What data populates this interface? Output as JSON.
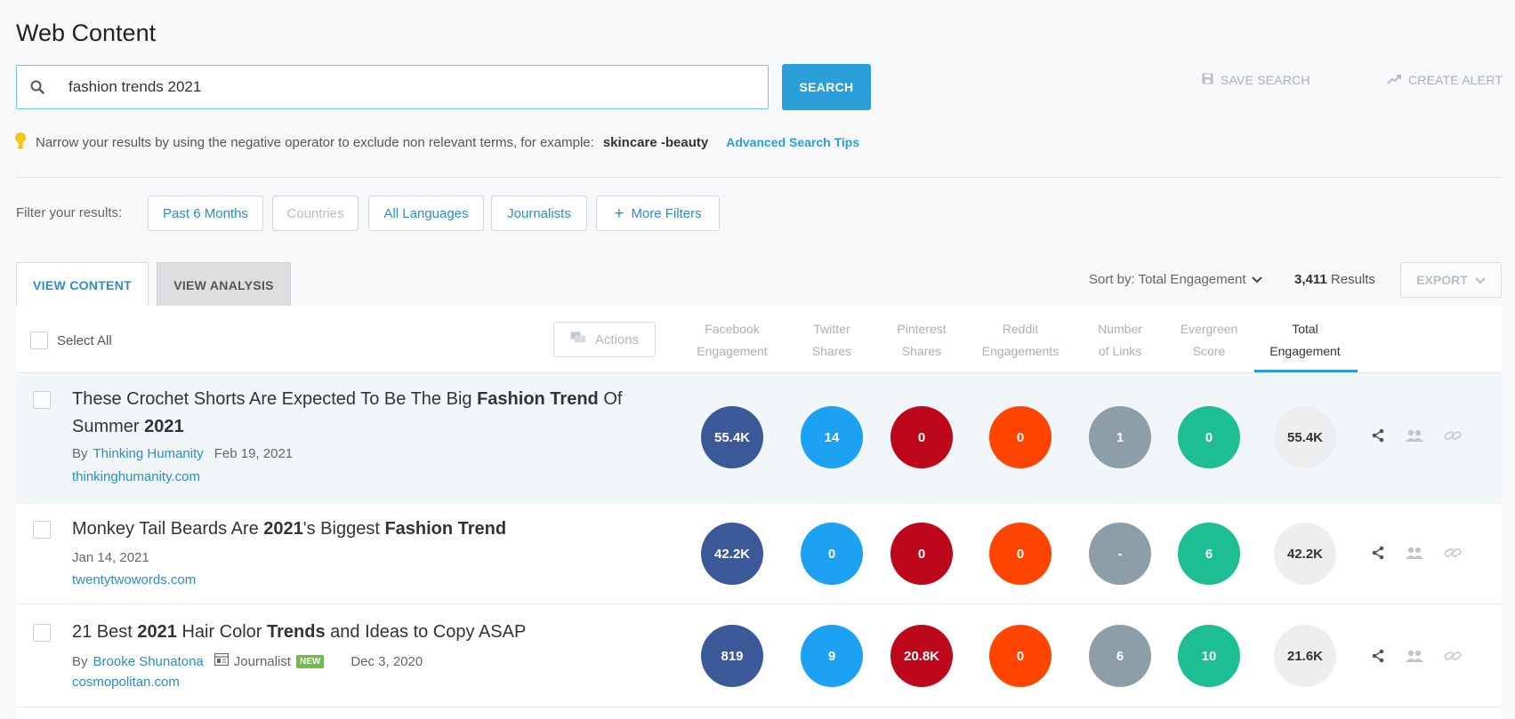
{
  "page": {
    "title": "Web Content"
  },
  "search": {
    "value": "fashion trends 2021",
    "button_label": "SEARCH",
    "save_search_label": "SAVE SEARCH",
    "create_alert_label": "CREATE ALERT"
  },
  "tip": {
    "text": "Narrow your results by using the negative operator to exclude non relevant terms, for example:",
    "example": "skincare -beauty",
    "link_label": "Advanced Search Tips"
  },
  "filters": {
    "label": "Filter your results:",
    "chips": [
      "Past 6 Months",
      "Countries",
      "All Languages",
      "Journalists",
      "More Filters"
    ]
  },
  "tabs": {
    "view_content": "VIEW CONTENT",
    "view_analysis": "VIEW ANALYSIS"
  },
  "toolbar": {
    "sort_label": "Sort by: Total Engagement",
    "results_count": "3,411",
    "results_label": "Results",
    "export_label": "EXPORT"
  },
  "table": {
    "select_all_label": "Select All",
    "actions_label": "Actions",
    "columns": [
      {
        "line1": "Facebook",
        "line2": "Engagement"
      },
      {
        "line1": "Twitter",
        "line2": "Shares"
      },
      {
        "line1": "Pinterest",
        "line2": "Shares"
      },
      {
        "line1": "Reddit",
        "line2": "Engagements"
      },
      {
        "line1": "Number",
        "line2": "of Links"
      },
      {
        "line1": "Evergreen",
        "line2": "Score"
      },
      {
        "line1": "Total",
        "line2": "Engagement"
      }
    ],
    "rows": [
      {
        "title_parts": [
          "These Crochet Shorts Are Expected To Be The Big ",
          "Fashion Trend",
          " Of",
          "Summer ",
          "2021"
        ],
        "by": "By",
        "author": "Thinking Humanity",
        "date": "Feb 19, 2021",
        "domain": "thinkinghumanity.com",
        "facebook": "55.4K",
        "twitter": "14",
        "pinterest": "0",
        "reddit": "0",
        "links": "1",
        "evergreen": "0",
        "total": "55.4K"
      },
      {
        "title_parts": [
          "Monkey Tail Beards Are ",
          "2021",
          "'s Biggest ",
          "Fashion Trend"
        ],
        "date": "Jan 14, 2021",
        "domain": "twentytwowords.com",
        "facebook": "42.2K",
        "twitter": "0",
        "pinterest": "0",
        "reddit": "0",
        "links": "-",
        "evergreen": "6",
        "total": "42.2K"
      },
      {
        "title_parts": [
          "21 Best ",
          "2021",
          " Hair Color ",
          "Trends",
          " and Ideas to Copy ASAP"
        ],
        "by": "By",
        "author": "Brooke Shunatona",
        "role": "Journalist",
        "badge": "NEW",
        "date": "Dec 3, 2020",
        "domain": "cosmopolitan.com",
        "facebook": "819",
        "twitter": "9",
        "pinterest": "20.8K",
        "reddit": "0",
        "links": "6",
        "evergreen": "10",
        "total": "21.6K"
      }
    ]
  },
  "colors": {
    "accent": "#2b9fd9",
    "facebook": "#3b5998",
    "twitter": "#1da1f2",
    "pinterest": "#bd081c",
    "reddit": "#ff4500",
    "links": "#8e9ea8",
    "evergreen": "#1ebe95"
  }
}
